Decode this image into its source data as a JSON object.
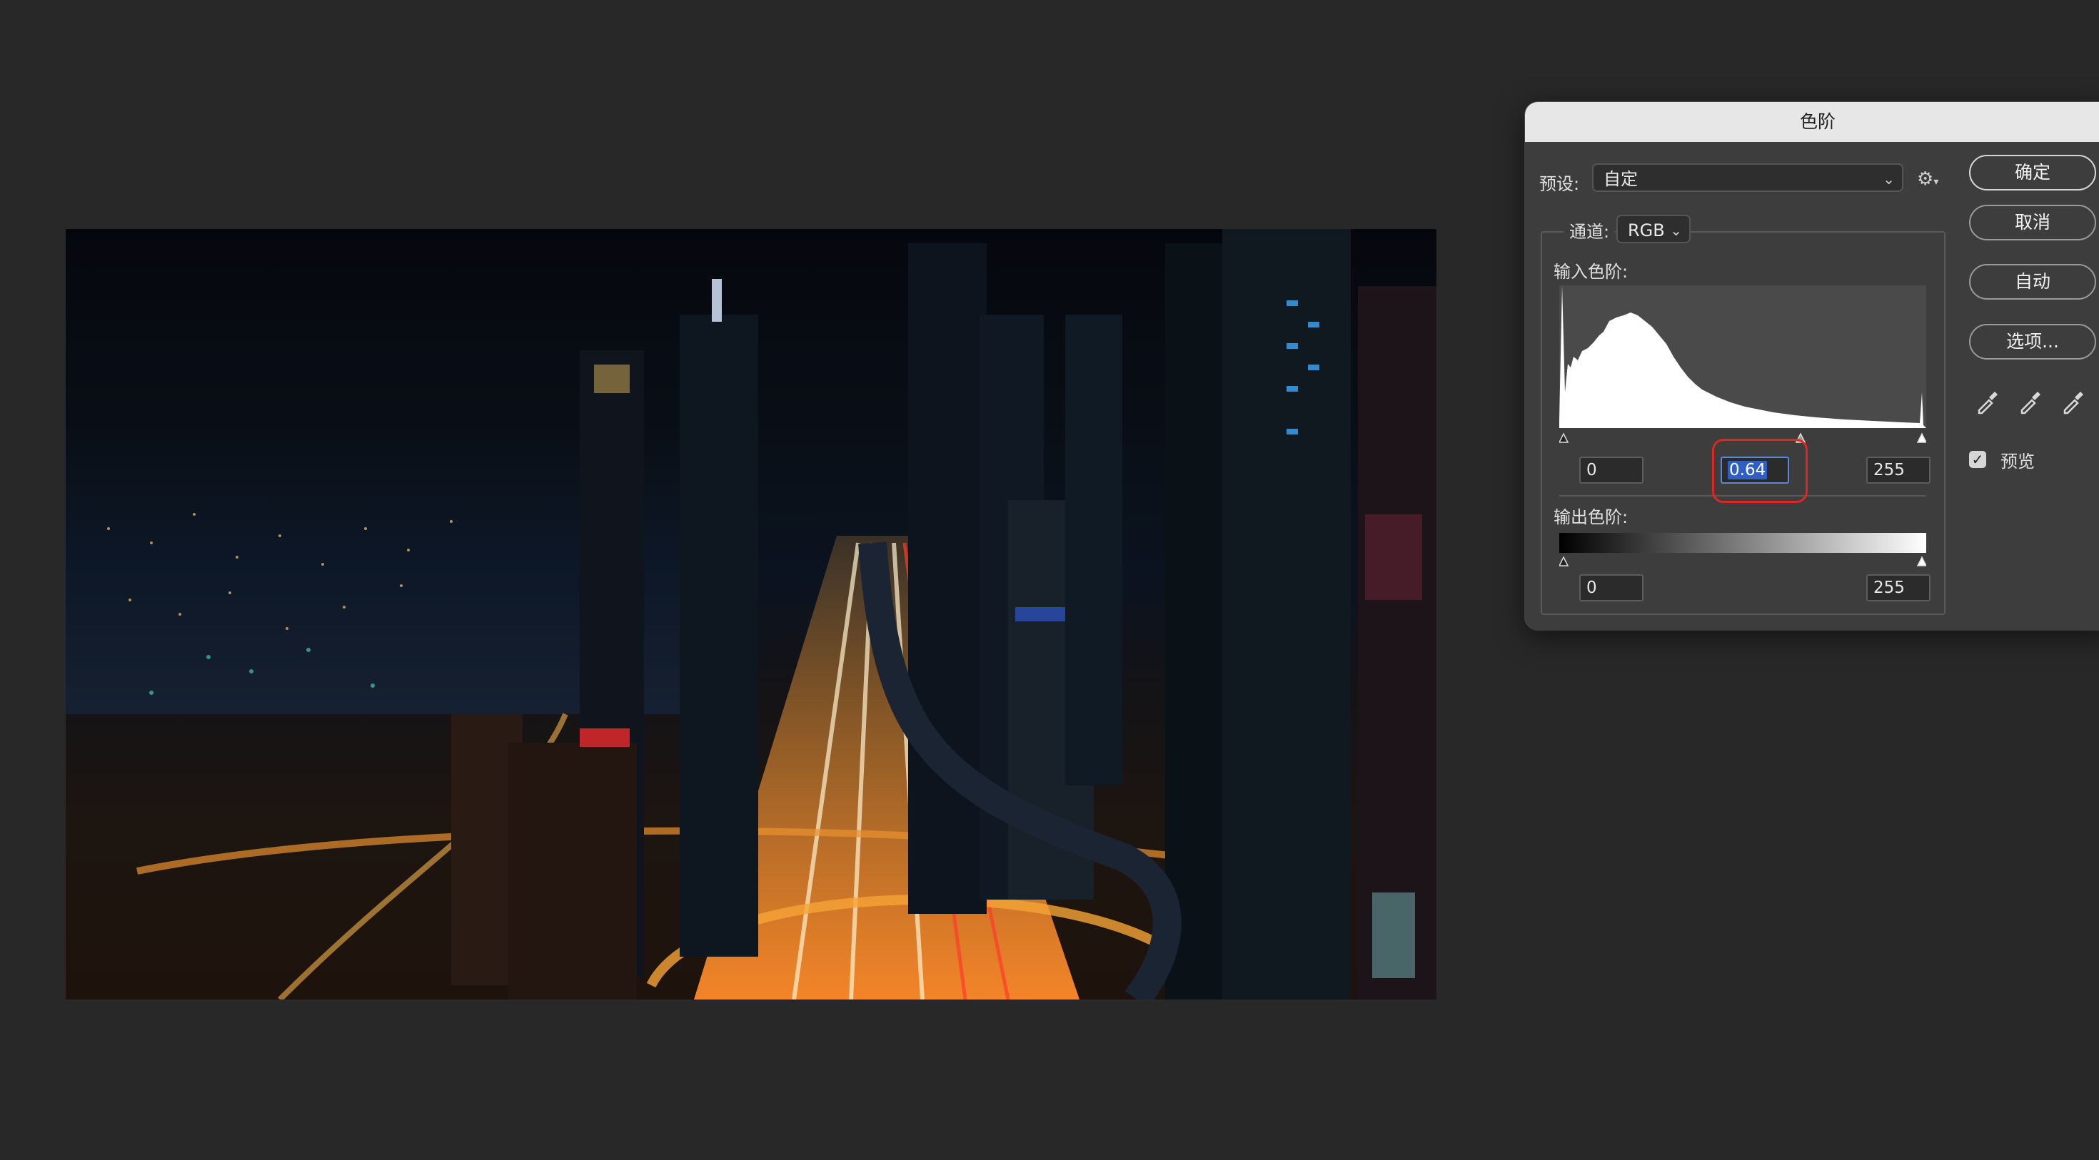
{
  "dialog": {
    "title": "色阶",
    "preset_label": "预设:",
    "preset_value": "自定",
    "gear_icon": "gear-icon",
    "channel_label": "通道:",
    "channel_value": "RGB",
    "input_levels_label": "输入色阶:",
    "output_levels_label": "输出色阶:",
    "input_black": "0",
    "input_gamma": "0.64",
    "input_white": "255",
    "output_black": "0",
    "output_white": "255",
    "preview_label": "预览",
    "preview_checked": true,
    "buttons": {
      "ok": "确定",
      "cancel": "取消",
      "auto": "自动",
      "options": "选项..."
    }
  },
  "colors": {
    "canvas_bg": "#282828",
    "dialog_bg": "#3d3d3d",
    "title_bar": "#e7e7e7",
    "highlight_ring": "#e0261f",
    "selection": "#2f5fc4"
  }
}
